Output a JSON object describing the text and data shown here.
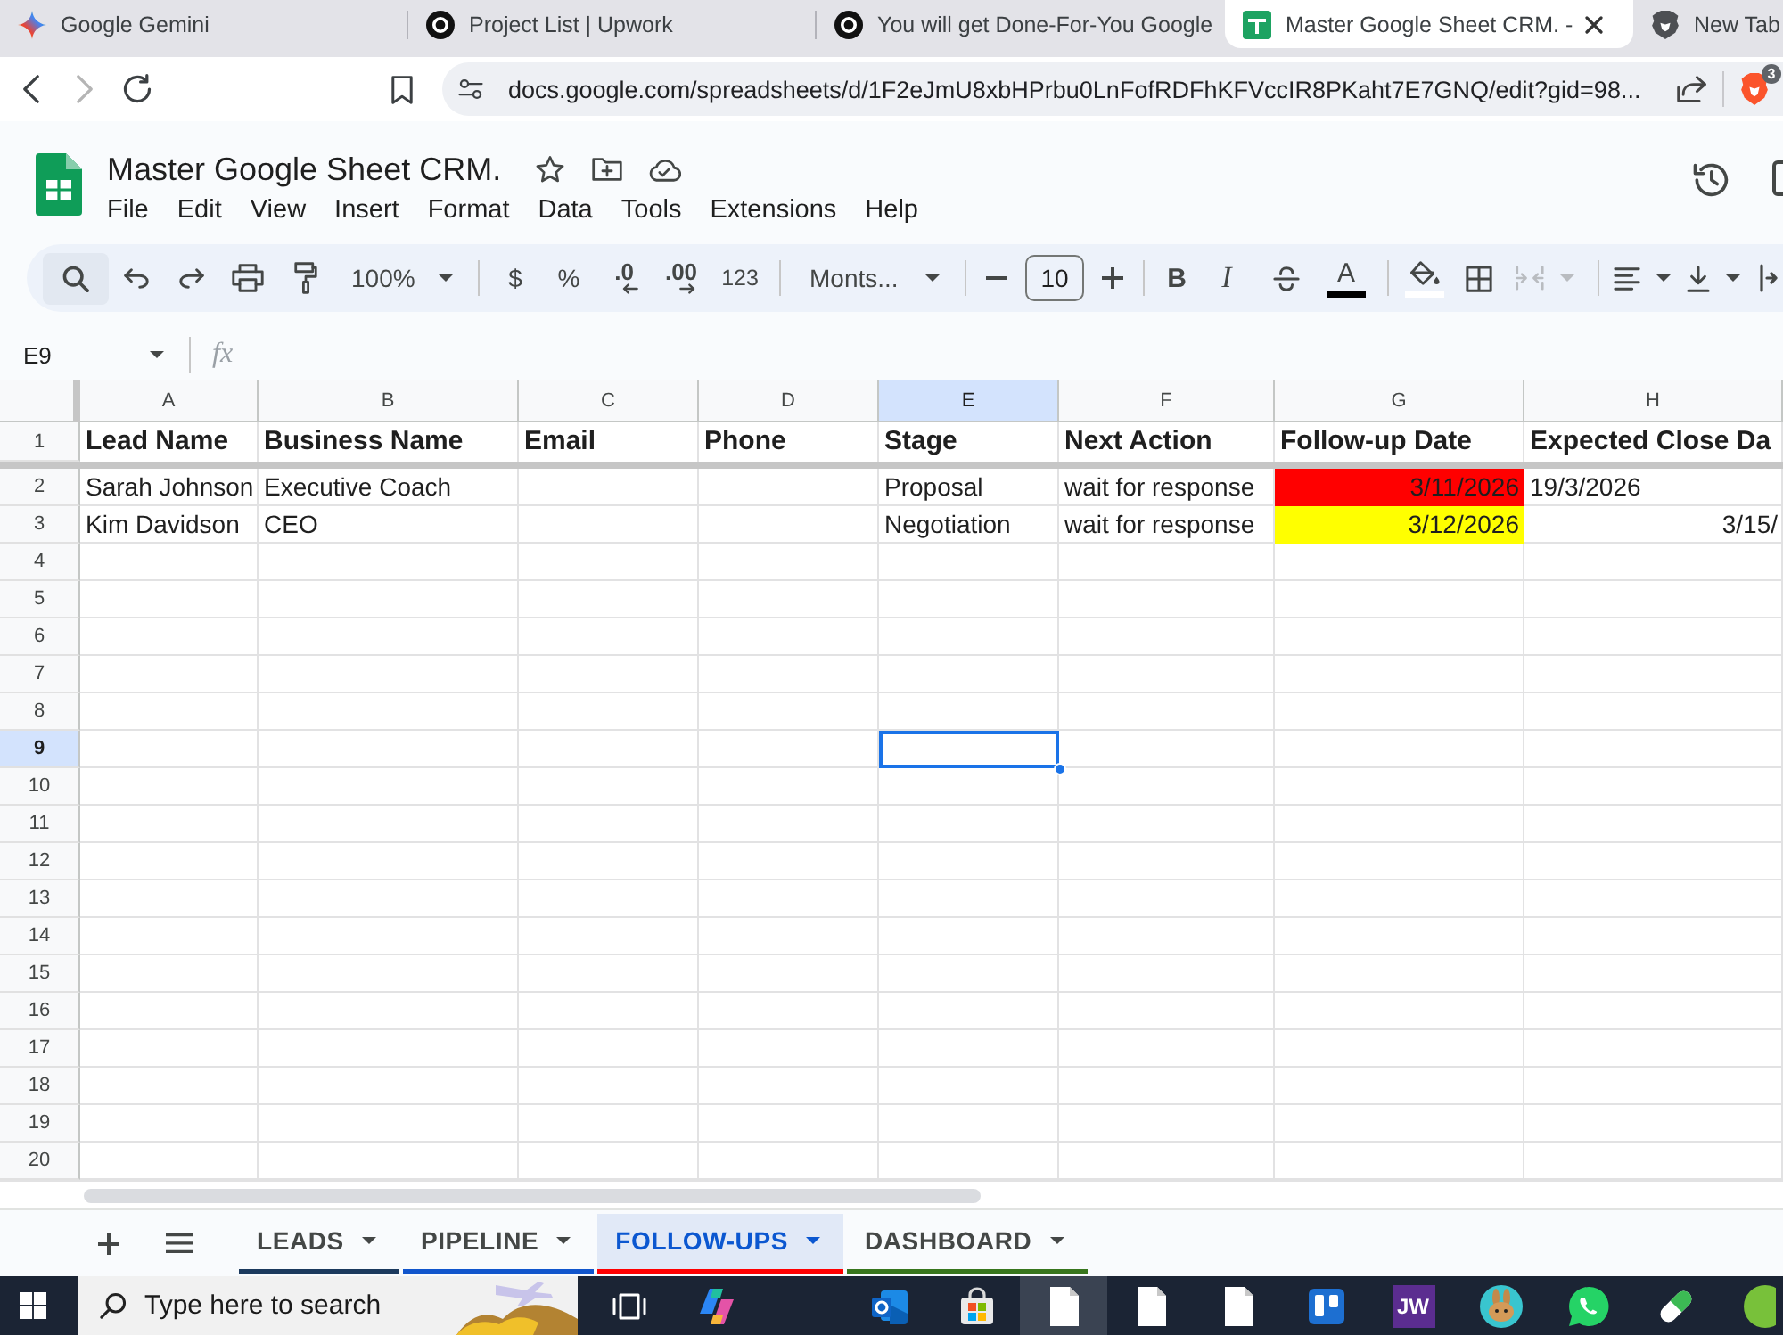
{
  "browser": {
    "tabs": [
      {
        "title": "Google Gemini",
        "kind": "sparkle",
        "selected": false
      },
      {
        "title": "Project List | Upwork",
        "kind": "circle",
        "selected": false
      },
      {
        "title": "You will get Done-For-You Google",
        "kind": "circle",
        "selected": false
      },
      {
        "title": "Master Google Sheet CRM. -",
        "kind": "sheet",
        "selected": true
      },
      {
        "title": "New Tab",
        "kind": "shield",
        "selected": false
      }
    ],
    "back_disabled": false,
    "forward_disabled": true,
    "url": "docs.google.com/spreadsheets/d/1F2eJmU8xbHPrbu0LnFofRDFhKFVccIR8PKaht7E7GNQ/edit?gid=98...",
    "shields_count": "3"
  },
  "document": {
    "title": "Master Google Sheet CRM.",
    "menus": [
      "File",
      "Edit",
      "View",
      "Insert",
      "Format",
      "Data",
      "Tools",
      "Extensions",
      "Help"
    ]
  },
  "toolbar": {
    "zoom": "100%",
    "currency": "$",
    "percent": "%",
    "decrease_decimals": ".0",
    "increase_decimals": ".00",
    "number_format": "123",
    "font": "Monts...",
    "font_size": "10",
    "bold": "B",
    "italic": "I",
    "text_color": {
      "label": "A",
      "color": "#000000"
    },
    "fill_color": {
      "color": "#ffffff"
    },
    "merge_disabled": true
  },
  "formula_bar": {
    "name_box": "E9",
    "fx": "fx"
  },
  "grid": {
    "columns": [
      {
        "letter": "A",
        "selected": false
      },
      {
        "letter": "B",
        "selected": false
      },
      {
        "letter": "C",
        "selected": false
      },
      {
        "letter": "D",
        "selected": false
      },
      {
        "letter": "E",
        "selected": true
      },
      {
        "letter": "F",
        "selected": false
      },
      {
        "letter": "G",
        "selected": false
      },
      {
        "letter": "H",
        "selected": false
      }
    ],
    "rows": [
      {
        "number": "1",
        "kind": "header",
        "selected": false,
        "cells": [
          {
            "text": "Lead Name",
            "kind": "text"
          },
          {
            "text": "Business Name",
            "kind": "text"
          },
          {
            "text": "Email",
            "kind": "text"
          },
          {
            "text": "Phone",
            "kind": "text"
          },
          {
            "text": "Stage",
            "kind": "text"
          },
          {
            "text": "Next Action",
            "kind": "text"
          },
          {
            "text": "Follow-up Date",
            "kind": "text"
          },
          {
            "text": "Expected Close Da",
            "kind": "text"
          }
        ]
      },
      {
        "number": "2",
        "kind": "data",
        "selected": false,
        "cells": [
          {
            "text": "Sarah Johnson",
            "kind": "text"
          },
          {
            "text": "Executive Coach",
            "kind": "text"
          },
          null,
          null,
          {
            "text": "Proposal",
            "kind": "text"
          },
          {
            "text": "wait for response",
            "kind": "text"
          },
          {
            "text": "3/11/2026",
            "kind": "date",
            "color": "#ff0000"
          },
          {
            "text": "19/3/2026",
            "kind": "text"
          }
        ]
      },
      {
        "number": "3",
        "kind": "data",
        "selected": false,
        "cells": [
          {
            "text": "Kim Davidson",
            "kind": "text"
          },
          {
            "text": "CEO",
            "kind": "text"
          },
          null,
          null,
          {
            "text": "Negotiation",
            "kind": "text"
          },
          {
            "text": "wait for response",
            "kind": "text"
          },
          {
            "text": "3/12/2026",
            "kind": "date",
            "color": "#ffff00"
          },
          {
            "text": "3/15/",
            "kind": "date"
          }
        ]
      },
      {
        "number": "4",
        "kind": "data",
        "selected": false
      },
      {
        "number": "5",
        "kind": "data",
        "selected": false
      },
      {
        "number": "6",
        "kind": "data",
        "selected": false
      },
      {
        "number": "7",
        "kind": "data",
        "selected": false
      },
      {
        "number": "8",
        "kind": "data",
        "selected": false
      },
      {
        "number": "9",
        "kind": "data",
        "selected": true
      },
      {
        "number": "10",
        "kind": "data",
        "selected": false
      },
      {
        "number": "11",
        "kind": "data",
        "selected": false
      },
      {
        "number": "12",
        "kind": "data",
        "selected": false
      },
      {
        "number": "13",
        "kind": "data",
        "selected": false
      },
      {
        "number": "14",
        "kind": "data",
        "selected": false
      },
      {
        "number": "15",
        "kind": "data",
        "selected": false
      },
      {
        "number": "16",
        "kind": "data",
        "selected": false
      },
      {
        "number": "17",
        "kind": "data",
        "selected": false
      },
      {
        "number": "18",
        "kind": "data",
        "selected": false
      },
      {
        "number": "19",
        "kind": "data",
        "selected": false
      },
      {
        "number": "20",
        "kind": "data",
        "selected": false
      }
    ]
  },
  "sheet_tabs": [
    {
      "label": "LEADS",
      "color": "#1c3a5e",
      "selected": false
    },
    {
      "label": "PIPELINE",
      "color": "#1155cc",
      "selected": false
    },
    {
      "label": "FOLLOW-UPS",
      "color": "#ff0000",
      "selected": true
    },
    {
      "label": "DASHBOARD",
      "color": "#38761d",
      "selected": false
    }
  ],
  "taskbar": {
    "search": {
      "placeholder": "Type here to search"
    },
    "apps": [
      {
        "kind": "task-view",
        "selected": false
      },
      {
        "kind": "swirl",
        "selected": false
      },
      {
        "kind": "mail",
        "selected": false
      },
      {
        "kind": "store",
        "selected": false
      },
      {
        "kind": "document",
        "selected": true
      },
      {
        "kind": "document",
        "selected": false
      },
      {
        "kind": "document",
        "selected": false
      },
      {
        "kind": "board",
        "selected": false
      },
      {
        "kind": "tile",
        "label": "JW",
        "selected": false
      },
      {
        "kind": "rabbit",
        "selected": false
      },
      {
        "kind": "phone",
        "selected": false
      },
      {
        "kind": "capsule",
        "selected": false
      },
      {
        "kind": "circle",
        "selected": false
      }
    ]
  }
}
